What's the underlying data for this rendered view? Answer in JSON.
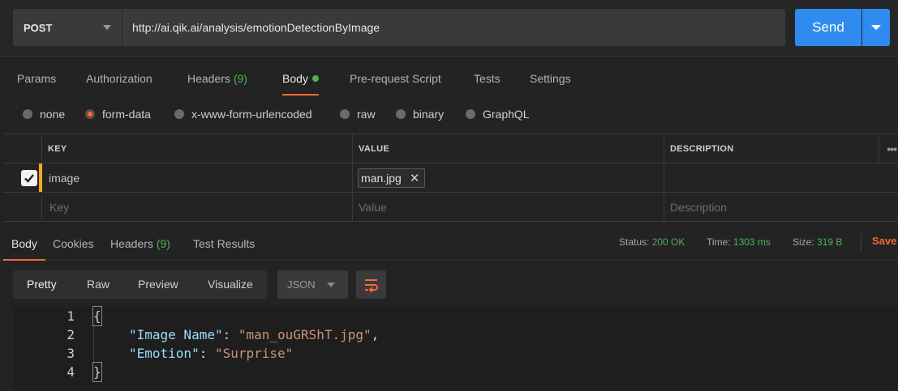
{
  "request": {
    "method": "POST",
    "url": "http://ai.qik.ai/analysis/emotionDetectionByImage",
    "send_label": "Send"
  },
  "request_tabs": [
    {
      "label": "Params"
    },
    {
      "label": "Authorization"
    },
    {
      "label": "Headers",
      "count": "(9)"
    },
    {
      "label": "Body"
    },
    {
      "label": "Pre-request Script"
    },
    {
      "label": "Tests"
    },
    {
      "label": "Settings"
    }
  ],
  "body_types": [
    "none",
    "form-data",
    "x-www-form-urlencoded",
    "raw",
    "binary",
    "GraphQL"
  ],
  "body_type_selected": "form-data",
  "table": {
    "headers": {
      "key": "KEY",
      "value": "VALUE",
      "description": "DESCRIPTION"
    },
    "row": {
      "key": "image",
      "file": "man.jpg",
      "description": ""
    },
    "placeholders": {
      "key": "Key",
      "value": "Value",
      "description": "Description"
    }
  },
  "response_tabs": [
    {
      "label": "Body"
    },
    {
      "label": "Cookies"
    },
    {
      "label": "Headers",
      "count": "(9)"
    },
    {
      "label": "Test Results"
    }
  ],
  "response_meta": {
    "status_label": "Status:",
    "status": "200 OK",
    "time_label": "Time:",
    "time": "1303 ms",
    "size_label": "Size:",
    "size": "319 B",
    "save_label": "Save"
  },
  "view_modes": [
    "Pretty",
    "Raw",
    "Preview",
    "Visualize"
  ],
  "format": "JSON",
  "code": {
    "line_numbers": [
      "1",
      "2",
      "3",
      "4"
    ],
    "open_brace": "{",
    "close_brace": "}",
    "key1": "\"Image Name\"",
    "val1": "\"man_ouGRShT.jpg\"",
    "key2": "\"Emotion\"",
    "val2": "\"Surprise\"",
    "colon": ": ",
    "comma": ","
  },
  "colors": {
    "accent_orange": "#f26b3a",
    "send_blue": "#2f8bef",
    "success_green": "#4fb350",
    "row_marker": "#f5a623"
  }
}
